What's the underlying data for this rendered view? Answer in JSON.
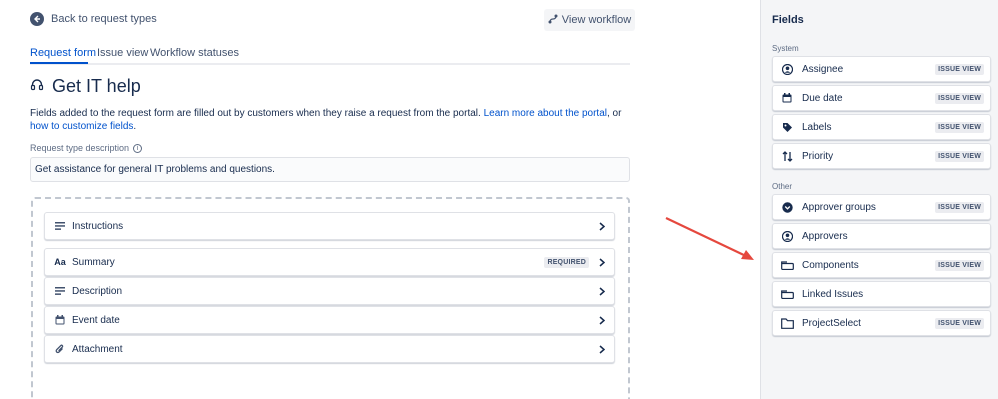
{
  "header": {
    "back_label": "Back to request types",
    "workflow_button": "View workflow"
  },
  "tabs": [
    {
      "label": "Request form",
      "active": true
    },
    {
      "label": "Issue view",
      "active": false
    },
    {
      "label": "Workflow statuses",
      "active": false
    }
  ],
  "page": {
    "icon": "headset-icon",
    "title": "Get IT help",
    "description_text": "Fields added to the request form are filled out by customers when they raise a request from the portal.",
    "learn_more_link": "Learn more about the portal",
    "or_text": ", or",
    "customize_link": "how to customize fields",
    "period": "."
  },
  "request_type": {
    "label": "Request type description",
    "value": "Get assistance for general IT problems and questions."
  },
  "form_fields": [
    {
      "label": "Instructions",
      "icon": "text-lines-icon",
      "badge": ""
    },
    {
      "label": "Summary",
      "icon": "text-aa-icon",
      "badge": "REQUIRED"
    },
    {
      "label": "Description",
      "icon": "text-lines-icon",
      "badge": ""
    },
    {
      "label": "Event date",
      "icon": "calendar-icon",
      "badge": ""
    },
    {
      "label": "Attachment",
      "icon": "paperclip-icon",
      "badge": ""
    }
  ],
  "sidebar": {
    "title": "Fields",
    "system_label": "System",
    "other_label": "Other",
    "system_fields": [
      {
        "label": "Assignee",
        "icon": "user-icon",
        "badge": "ISSUE VIEW"
      },
      {
        "label": "Due date",
        "icon": "calendar-icon",
        "badge": "ISSUE VIEW"
      },
      {
        "label": "Labels",
        "icon": "tag-icon",
        "badge": "ISSUE VIEW"
      },
      {
        "label": "Priority",
        "icon": "priority-arrows-icon",
        "badge": "ISSUE VIEW"
      }
    ],
    "other_fields": [
      {
        "label": "Approver groups",
        "icon": "chevron-circle-icon",
        "badge": "ISSUE VIEW"
      },
      {
        "label": "Approvers",
        "icon": "user-icon",
        "badge": ""
      },
      {
        "label": "Components",
        "icon": "component-icon",
        "badge": "ISSUE VIEW"
      },
      {
        "label": "Linked Issues",
        "icon": "component-icon",
        "badge": ""
      },
      {
        "label": "ProjectSelect",
        "icon": "folder-icon",
        "badge": "ISSUE VIEW"
      }
    ]
  },
  "colors": {
    "accent": "#0052cc",
    "arrow": "#e5483e",
    "sidebar_bg": "#f4f5f7"
  }
}
